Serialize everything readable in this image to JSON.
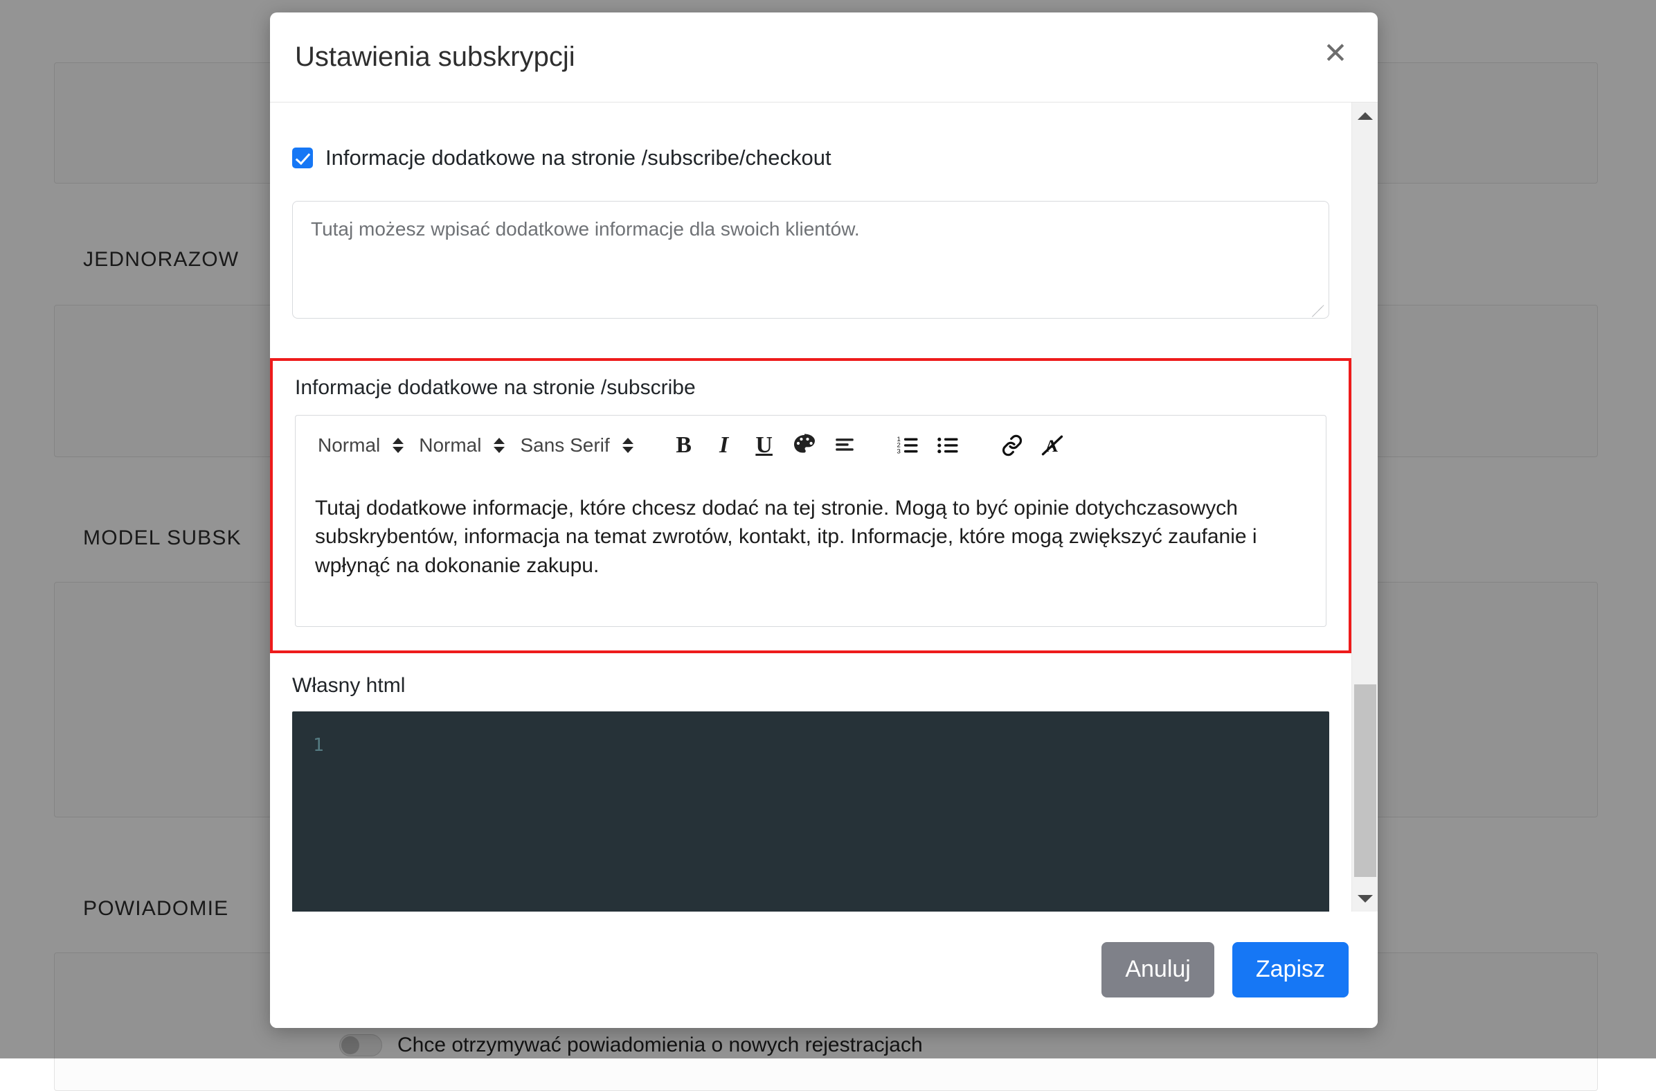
{
  "background": {
    "sections": [
      {
        "title": "JEDNORAZOW"
      },
      {
        "title": "MODEL SUBSK"
      },
      {
        "title": "POWIADOMIE"
      }
    ],
    "notification_toggle_label": "Chce otrzymywać powiadomienia o nowych rejestracjach"
  },
  "modal": {
    "title": "Ustawienia subskrypcji",
    "close_icon": "close-icon",
    "checkbox": {
      "checked": true,
      "label": "Informacje dodatkowe na stronie /subscribe/checkout"
    },
    "checkout_textarea": {
      "placeholder": "Tutaj możesz wpisać dodatkowe informacje dla swoich klientów.",
      "value": ""
    },
    "rich_text_section": {
      "label": "Informacje dodatkowe na stronie /subscribe",
      "highlight_color": "#ee1b1b",
      "toolbar": {
        "header_picker": "Normal",
        "size_picker": "Normal",
        "font_picker": "Sans Serif",
        "buttons": [
          {
            "name": "bold-icon",
            "glyph": "B"
          },
          {
            "name": "italic-icon",
            "glyph": "I"
          },
          {
            "name": "underline-icon",
            "glyph": "U"
          },
          {
            "name": "color-palette-icon",
            "glyph": ""
          },
          {
            "name": "align-icon",
            "glyph": ""
          },
          {
            "name": "ordered-list-icon",
            "glyph": ""
          },
          {
            "name": "bullet-list-icon",
            "glyph": ""
          },
          {
            "name": "link-icon",
            "glyph": ""
          },
          {
            "name": "clear-format-icon",
            "glyph": ""
          }
        ]
      },
      "content": "Tutaj dodatkowe informacje, które chcesz dodać na tej stronie. Mogą to być opinie dotychczasowych subskrybentów, informacja na temat zwrotów,  kontakt, itp. Informacje, które mogą zwiększyć zaufanie i wpłynąć na dokonanie zakupu."
    },
    "custom_html": {
      "label": "Własny html",
      "line_number": "1",
      "value": "",
      "background_color": "#263238"
    },
    "footer": {
      "cancel_label": "Anuluj",
      "save_label": "Zapisz",
      "cancel_color": "#7f8189",
      "save_color": "#1677f5"
    }
  }
}
